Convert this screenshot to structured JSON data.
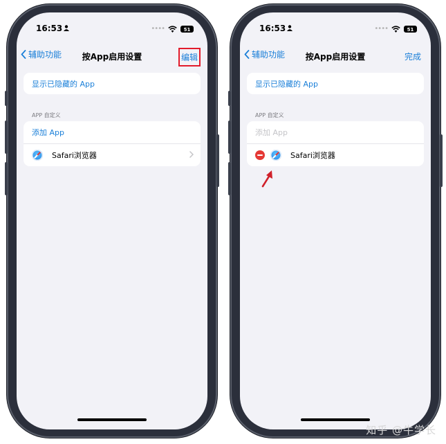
{
  "left": {
    "status": {
      "time": "16:53",
      "battery": "51"
    },
    "nav": {
      "back_label": "辅助功能",
      "title": "按App启用设置",
      "action": "编辑"
    },
    "show_hidden": "显示已隐藏的 App",
    "section_header": "APP 自定义",
    "add_app": "添加 App",
    "app_name": "Safari浏览器"
  },
  "right": {
    "status": {
      "time": "16:53",
      "battery": "51"
    },
    "nav": {
      "back_label": "辅助功能",
      "title": "按App启用设置",
      "action": "完成"
    },
    "show_hidden": "显示已隐藏的 App",
    "section_header": "APP 自定义",
    "add_app": "添加 App",
    "app_name": "Safari浏览器"
  },
  "watermark": "知乎 @牛学长",
  "colors": {
    "accent": "#1a7fd8",
    "highlight_box": "#e21b2b",
    "delete_red": "#e53935",
    "arrow": "#d0202a"
  },
  "icons": [
    "person-icon",
    "signal-dots-icon",
    "wifi-icon",
    "battery-icon",
    "chevron-left-icon",
    "safari-icon",
    "chevron-right-icon",
    "minus-circle-icon",
    "arrow-icon"
  ]
}
